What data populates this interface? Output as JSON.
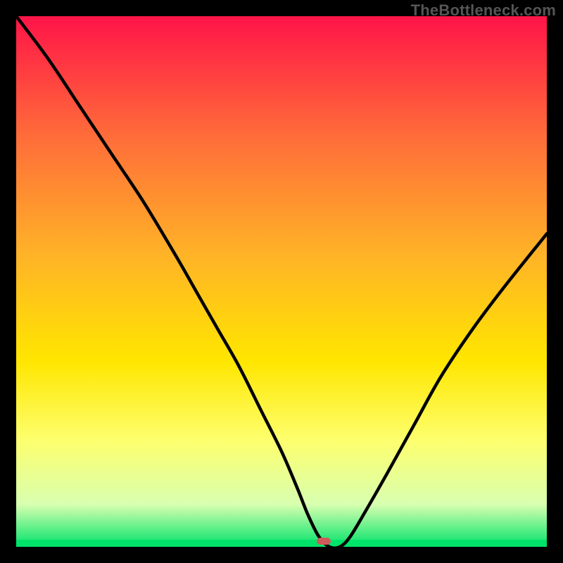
{
  "watermark": "TheBottleneck.com",
  "colors": {
    "background_black": "#000000",
    "gradient_top": "#ff1448",
    "gradient_mid1": "#ff6a3a",
    "gradient_mid2": "#ffb327",
    "gradient_mid3": "#ffe600",
    "gradient_mid4": "#fdff6e",
    "gradient_bottom_pale": "#d8ffb0",
    "gradient_green": "#00e36a",
    "curve_stroke": "#000000",
    "marker_fill": "#d05a5a"
  },
  "marker": {
    "x_pct": 58.0,
    "y_pct": 99.0
  },
  "chart_data": {
    "type": "line",
    "title": "",
    "xlabel": "",
    "ylabel": "",
    "xlim": [
      0,
      100
    ],
    "ylim": [
      0,
      100
    ],
    "series": [
      {
        "name": "bottleneck-curve",
        "x": [
          0,
          6,
          12,
          18,
          24,
          30,
          34,
          38,
          42,
          46,
          50,
          53,
          55,
          57,
          59,
          61,
          63,
          66,
          70,
          75,
          80,
          86,
          92,
          100
        ],
        "values": [
          100,
          92,
          83,
          74,
          65,
          55,
          48,
          41,
          34,
          26,
          18,
          11,
          6,
          2,
          0,
          0,
          2,
          7,
          14,
          23,
          32,
          41,
          49,
          59
        ]
      }
    ],
    "marker_point": {
      "x": 58,
      "y": 0
    },
    "gradient_stops": [
      {
        "pct": 0,
        "color": "#ff1448"
      },
      {
        "pct": 22,
        "color": "#ff6a3a"
      },
      {
        "pct": 45,
        "color": "#ffb327"
      },
      {
        "pct": 65,
        "color": "#ffe600"
      },
      {
        "pct": 80,
        "color": "#fdff6e"
      },
      {
        "pct": 92,
        "color": "#d8ffb0"
      },
      {
        "pct": 100,
        "color": "#00e36a"
      }
    ]
  }
}
